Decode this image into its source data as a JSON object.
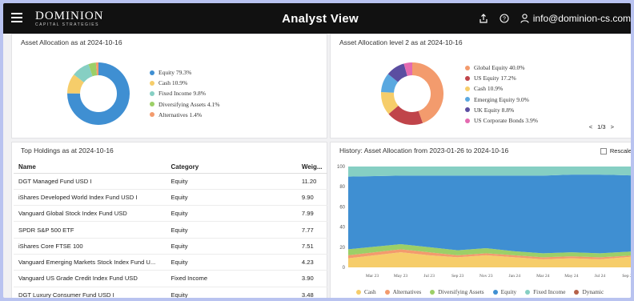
{
  "header": {
    "logo_main": "DOMINION",
    "logo_sub": "CAPITAL STRATEGIES",
    "title": "Analyst View",
    "user_email": "info@dominion-cs.com"
  },
  "allocation": {
    "title": "Asset Allocation as at 2024-10-16",
    "items": [
      {
        "label": "Equity 79.3%",
        "value": 79.3,
        "color": "#3f8fd2"
      },
      {
        "label": "Cash 10.9%",
        "value": 10.9,
        "color": "#f6cd6a"
      },
      {
        "label": "Fixed Income 9.8%",
        "value": 9.8,
        "color": "#86cfc3"
      },
      {
        "label": "Diversifying Assets 4.1%",
        "value": 4.1,
        "color": "#9ccf67"
      },
      {
        "label": "Alternatives 1.4%",
        "value": 1.4,
        "color": "#f39b6d"
      }
    ]
  },
  "allocation_l2": {
    "title": "Asset Allocation level 2 as at 2024-10-16",
    "items": [
      {
        "label": "Global Equity 40.0%",
        "value": 40.0,
        "color": "#f39b6d"
      },
      {
        "label": "US Equity 17.2%",
        "value": 17.2,
        "color": "#c0444a"
      },
      {
        "label": "Cash 10.9%",
        "value": 10.9,
        "color": "#f6cd6a"
      },
      {
        "label": "Emerging Equity 9.0%",
        "value": 9.0,
        "color": "#5aa8e0"
      },
      {
        "label": "UK Equity 8.8%",
        "value": 8.8,
        "color": "#5b4ea1"
      },
      {
        "label": "US Corporate Bonds 3.9%",
        "value": 3.9,
        "color": "#e46ab0"
      }
    ],
    "pager": {
      "prev": "<",
      "text": "1/3",
      "next": ">"
    }
  },
  "holdings": {
    "title": "Top Holdings as at 2024-10-16",
    "columns": [
      "Name",
      "Category",
      "Weig..."
    ],
    "rows": [
      [
        "DGT Managed Fund USD I",
        "Equity",
        "11.20"
      ],
      [
        "iShares Developed World Index Fund USD I",
        "Equity",
        "9.90"
      ],
      [
        "Vanguard Global Stock Index Fund USD",
        "Equity",
        "7.99"
      ],
      [
        "SPDR S&P 500 ETF",
        "Equity",
        "7.77"
      ],
      [
        "iShares Core FTSE 100",
        "Equity",
        "7.51"
      ],
      [
        "Vanguard Emerging Markets Stock Index Fund U...",
        "Equity",
        "4.23"
      ],
      [
        "Vanguard US Grade Credit Index Fund USD",
        "Fixed Income",
        "3.90"
      ],
      [
        "DGT Luxury Consumer Fund USD I",
        "Equity",
        "3.48"
      ]
    ]
  },
  "history": {
    "title": "History: Asset Allocation from 2023-01-26 to 2024-10-16",
    "rescale_label": "Rescale"
  },
  "chart_data": [
    {
      "type": "pie",
      "title": "Asset Allocation as at 2024-10-16",
      "categories": [
        "Equity",
        "Cash",
        "Fixed Income",
        "Diversifying Assets",
        "Alternatives"
      ],
      "values": [
        79.3,
        10.9,
        9.8,
        4.1,
        1.4
      ]
    },
    {
      "type": "pie",
      "title": "Asset Allocation level 2 as at 2024-10-16",
      "categories": [
        "Global Equity",
        "US Equity",
        "Cash",
        "Emerging Equity",
        "UK Equity",
        "US Corporate Bonds"
      ],
      "values": [
        40.0,
        17.2,
        10.9,
        9.0,
        8.8,
        3.9
      ]
    },
    {
      "type": "area",
      "title": "History: Asset Allocation from 2023-01-26 to 2024-10-16",
      "x": [
        "Mar 23",
        "May 23",
        "Jul 23",
        "Sep 23",
        "Nov 23",
        "Jan 24",
        "Mar 24",
        "May 24",
        "Jul 24",
        "Sep 24"
      ],
      "ylim": [
        0,
        100
      ],
      "yticks": [
        0,
        20,
        40,
        60,
        80,
        100
      ],
      "series": [
        {
          "name": "Cash",
          "color": "#f6cd6a",
          "values": [
            9,
            15,
            12,
            10,
            12,
            10,
            8,
            9,
            8,
            11
          ]
        },
        {
          "name": "Alternatives",
          "color": "#f39b6d",
          "values": [
            3,
            3,
            3,
            2,
            2,
            2,
            2,
            2,
            2,
            1
          ]
        },
        {
          "name": "Diversifying Assets",
          "color": "#9ccf67",
          "values": [
            6,
            5,
            5,
            5,
            5,
            4,
            4,
            4,
            4,
            4
          ]
        },
        {
          "name": "Equity",
          "color": "#3f8fd2",
          "values": [
            72,
            68,
            71,
            74,
            72,
            75,
            77,
            77,
            78,
            75
          ]
        },
        {
          "name": "Fixed Income",
          "color": "#86cfc3",
          "values": [
            10,
            9,
            9,
            9,
            9,
            9,
            9,
            8,
            8,
            9
          ]
        },
        {
          "name": "Dynamic",
          "color": "#b5614a",
          "values": [
            0,
            0,
            0,
            0,
            0,
            0,
            0,
            0,
            0,
            0
          ]
        }
      ]
    }
  ]
}
